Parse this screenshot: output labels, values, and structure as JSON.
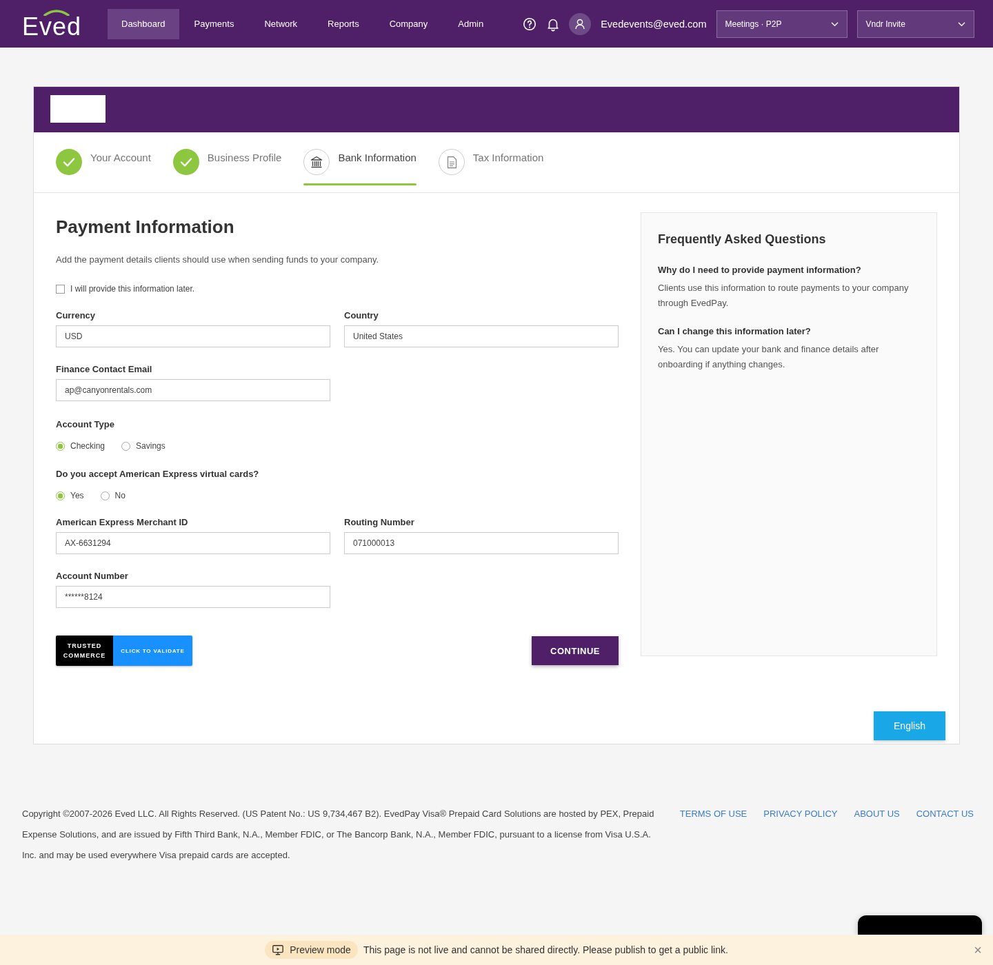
{
  "nav": {
    "logo": "Eved",
    "items": [
      {
        "label": "Dashboard",
        "selected": true
      },
      {
        "label": "Payments",
        "selected": false
      },
      {
        "label": "Network",
        "selected": false
      },
      {
        "label": "Reports",
        "selected": false
      },
      {
        "label": "Company",
        "selected": false
      },
      {
        "label": "Admin",
        "selected": false
      }
    ],
    "user_email": "Evedevents@eved.com",
    "dropdowns": [
      "Meetings · P2P",
      "Vndr Invite"
    ]
  },
  "steps": [
    {
      "label": "Your Account",
      "kind": "done",
      "selected": false
    },
    {
      "label": "Business Profile",
      "kind": "done",
      "selected": false
    },
    {
      "label": "Bank Information",
      "kind": "bank",
      "selected": true
    },
    {
      "label": "Tax Information",
      "kind": "document",
      "selected": false
    }
  ],
  "form": {
    "title": "Payment Information",
    "description": "Add the payment details clients should use when sending funds to your company.",
    "later_checkbox": {
      "label": "I will provide this information later.",
      "checked": false
    },
    "sections": [
      {
        "kind": "fields",
        "fields": [
          {
            "label": "Currency",
            "value": "USD"
          },
          {
            "label": "Country",
            "value": "United States"
          }
        ]
      },
      {
        "kind": "fields",
        "fields": [
          {
            "label": "Finance Contact Email",
            "value": "ap@canyonrentals.com"
          }
        ]
      },
      {
        "kind": "radios",
        "label": "Account Type",
        "options": [
          {
            "label": "Checking",
            "selected": true
          },
          {
            "label": "Savings",
            "selected": false
          }
        ]
      },
      {
        "kind": "radios",
        "label": "Do you accept American Express virtual cards?",
        "options": [
          {
            "label": "Yes",
            "selected": true
          },
          {
            "label": "No",
            "selected": false
          }
        ]
      },
      {
        "kind": "fields",
        "fields": [
          {
            "label": "American Express Merchant ID",
            "value": "AX-6631294"
          },
          {
            "label": "Routing Number",
            "value": "071000013"
          }
        ]
      },
      {
        "kind": "fields",
        "fields": [
          {
            "label": "Account Number",
            "value": "******8124"
          }
        ]
      }
    ],
    "trust_badge": {
      "brand_lines": [
        "TRUSTED",
        "COMMERCE"
      ],
      "action": "CLICK TO VALIDATE"
    },
    "continue_button": "CONTINUE"
  },
  "faq": {
    "title": "Frequently Asked Questions",
    "items": [
      {
        "question": "Why do I need to provide payment information?",
        "answer": "Clients use this information to route payments to your company through EvedPay."
      },
      {
        "question": "Can I change this information later?",
        "answer": "Yes. You can update your bank and finance details after onboarding if anything changes."
      }
    ]
  },
  "language_button": "English",
  "footer": {
    "copyright": "Copyright ©2007-2026 Eved LLC. All Rights Reserved. (US Patent No.: US 9,734,467 B2). EvedPay Visa® Prepaid Card Solutions are hosted by PEX, Prepaid Expense Solutions, and are issued by Fifth Third Bank, N.A., Member FDIC, or The Bancorp Bank, N.A., Member FDIC, pursuant to a license from Visa U.S.A. Inc. and may be used everywhere Visa prepaid cards are accepted.",
    "links": [
      "TERMS OF USE",
      "PRIVACY POLICY",
      "ABOUT US",
      "CONTACT US"
    ]
  },
  "preview_bar": {
    "badge": "Preview mode",
    "message": "This page is not live and cannot be shared directly. Please publish to get a public link.",
    "close": "×"
  }
}
